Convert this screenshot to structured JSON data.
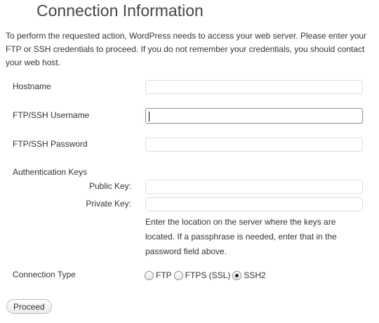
{
  "page": {
    "title": "Connection Information",
    "intro": "To perform the requested action, WordPress needs to access your web server. Please enter your FTP or SSH credentials to proceed. If you do not remember your credentials, you should contact your web host."
  },
  "form": {
    "hostname": {
      "label": "Hostname",
      "value": ""
    },
    "username": {
      "label": "FTP/SSH Username",
      "value": ""
    },
    "password": {
      "label": "FTP/SSH Password",
      "value": ""
    },
    "auth_keys": {
      "label": "Authentication Keys",
      "public_key_label": "Public Key:",
      "private_key_label": "Private Key:",
      "public_key_value": "",
      "private_key_value": "",
      "help_text": "Enter the location on the server where the keys are located. If a passphrase is needed, enter that in the password field above."
    },
    "connection_type": {
      "label": "Connection Type",
      "options": [
        {
          "label": "FTP",
          "selected": false
        },
        {
          "label": "FTPS (SSL)",
          "selected": false
        },
        {
          "label": "SSH2",
          "selected": true
        }
      ]
    },
    "proceed_label": "Proceed"
  }
}
